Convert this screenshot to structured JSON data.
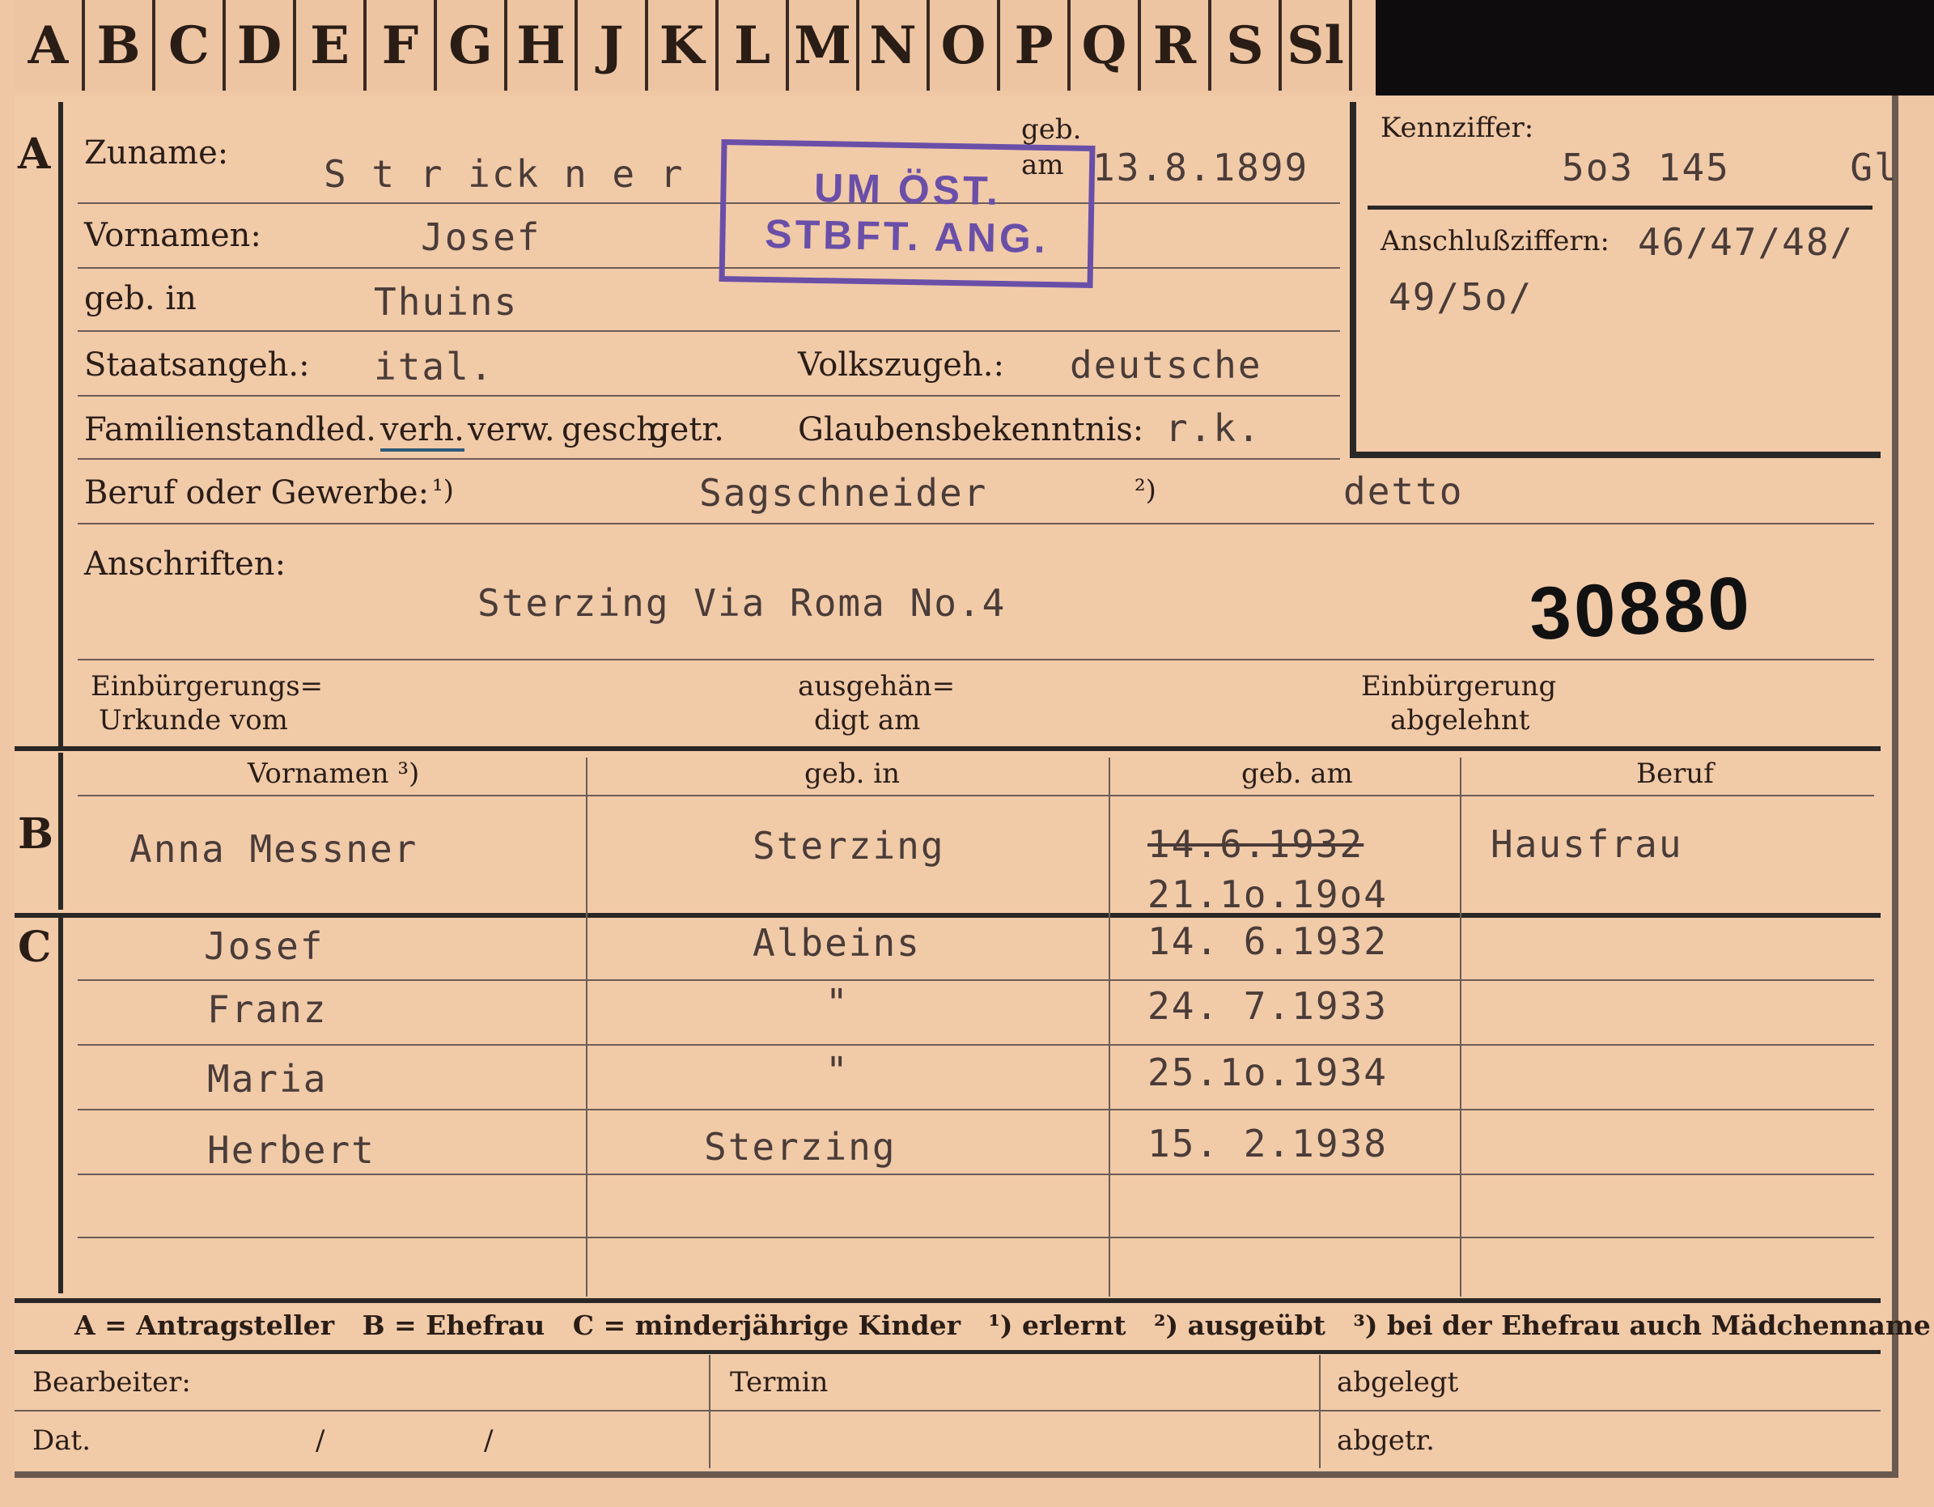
{
  "tabs": [
    "A",
    "B",
    "C",
    "D",
    "E",
    "F",
    "G",
    "H",
    "J",
    "K",
    "L",
    "M",
    "N",
    "O",
    "P",
    "Q",
    "R",
    "S",
    "Sl"
  ],
  "sections": {
    "a": "A",
    "b": "B",
    "c": "C"
  },
  "labels": {
    "zuname": "Zuname:",
    "vornamen": "Vornamen:",
    "geb_in": "geb. in",
    "geb_am_top": "geb.",
    "geb_am_bottom": "am",
    "staatsangeh": "Staatsangeh.:",
    "volkszugeh": "Volkszugeh.:",
    "familienstand": "Familienstand:",
    "fam_options": [
      "led.",
      "verh.",
      "verw.",
      "gesch.",
      "getr."
    ],
    "glaubensbekenntnis": "Glaubensbekenntnis:",
    "beruf": "Beruf oder Gewerbe:",
    "fn1": "¹)",
    "fn2": "²)",
    "anschriften": "Anschriften:",
    "einb_urkunde_1": "Einbürgerungs=",
    "einb_urkunde_2": "Urkunde vom",
    "ausgehaend_1": "ausgehän=",
    "ausgehaend_2": "digt am",
    "einb_abgelehnt_1": "Einbürgerung",
    "einb_abgelehnt_2": "abgelehnt",
    "kennziffer": "Kennziffer:",
    "anschlussziffern": "Anschlußziffern:",
    "col_vornamen": "Vornamen ³)",
    "col_geb_in": "geb. in",
    "col_geb_am": "geb. am",
    "col_beruf": "Beruf",
    "legend": "A = Antragsteller   B = Ehefrau   C = minderjährige Kinder   ¹) erlernt   ²) ausgeübt   ³) bei der Ehefrau auch Mädchenname",
    "bearbeiter": "Bearbeiter:",
    "termin": "Termin",
    "abgelegt": "abgelegt",
    "dat": "Dat.",
    "abgetr": "abgetr.",
    "slash": "/"
  },
  "values": {
    "zuname": "S t r ick n e r",
    "vornamen": "Josef",
    "geb_in": "Thuins",
    "geb_am": "13.8.1899",
    "staatsangeh": "ital.",
    "volkszugeh": "deutsche",
    "glaubensbekenntnis": "r.k.",
    "beruf_erlernt": "Sagschneider",
    "beruf_ausgeuebt": "detto",
    "anschrift": "Sterzing Via Roma No.4",
    "kennziffer": "5o3 145     Gl",
    "anschlussziffern_1": "46/47/48/",
    "anschlussziffern_2": "49/5o/",
    "big_number": "30880"
  },
  "stamp": {
    "line1": "UM ÖST.",
    "line2": "STBFT. ANG."
  },
  "ehefrau": {
    "vornamen": "Anna Messner",
    "geb_in": "Sterzing",
    "geb_am_struck": "14.6.1932",
    "geb_am": "21.1o.19o4",
    "beruf": "Hausfrau"
  },
  "kinder": [
    {
      "name": "Josef",
      "geb_in": "Albeins",
      "geb_am": "14. 6.1932"
    },
    {
      "name": "Franz",
      "geb_in": "\"",
      "geb_am": "24. 7.1933"
    },
    {
      "name": "Maria",
      "geb_in": "\"",
      "geb_am": "25.1o.1934"
    },
    {
      "name": "Herbert",
      "geb_in": "Sterzing",
      "geb_am": "15. 2.1938"
    }
  ],
  "colors": {
    "paper": "#f1caa8",
    "stamp": "#6a4fa8",
    "ink": "#2a1d16"
  }
}
